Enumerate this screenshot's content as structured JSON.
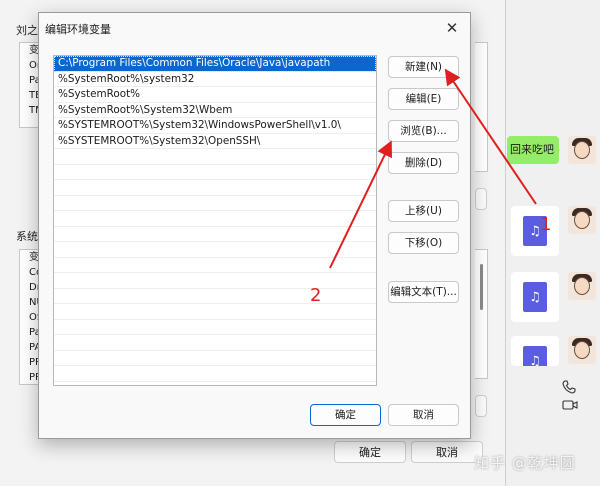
{
  "parent": {
    "user_group_label": "刘之",
    "user_vars": [
      "变",
      "On",
      "Pa",
      "TE",
      "TM"
    ],
    "system_group_label": "系统",
    "system_vars": [
      "变",
      "Co",
      "Dr",
      "NU",
      "OS",
      "Pa",
      "PA",
      "PR",
      "PR"
    ],
    "ok_label": "确定",
    "cancel_label": "取消"
  },
  "chat": {
    "bubble_text": "回来吃吧",
    "music_glyph": "♫"
  },
  "dialog": {
    "title": "编辑环境变量",
    "close_glyph": "✕",
    "paths": [
      "C:\\Program Files\\Common Files\\Oracle\\Java\\javapath",
      "%SystemRoot%\\system32",
      "%SystemRoot%",
      "%SystemRoot%\\System32\\Wbem",
      "%SYSTEMROOT%\\System32\\WindowsPowerShell\\v1.0\\",
      "%SYSTEMROOT%\\System32\\OpenSSH\\"
    ],
    "buttons": {
      "new": "新建(N)",
      "edit": "编辑(E)",
      "browse": "浏览(B)...",
      "delete": "删除(D)",
      "move_up": "上移(U)",
      "move_down": "下移(O)",
      "edit_text": "编辑文本(T)...",
      "ok": "确定",
      "cancel": "取消"
    }
  },
  "annotations": {
    "label_1": "1",
    "label_2": "2",
    "color": "#e02020"
  },
  "watermark": "知乎 @乾坤圆"
}
